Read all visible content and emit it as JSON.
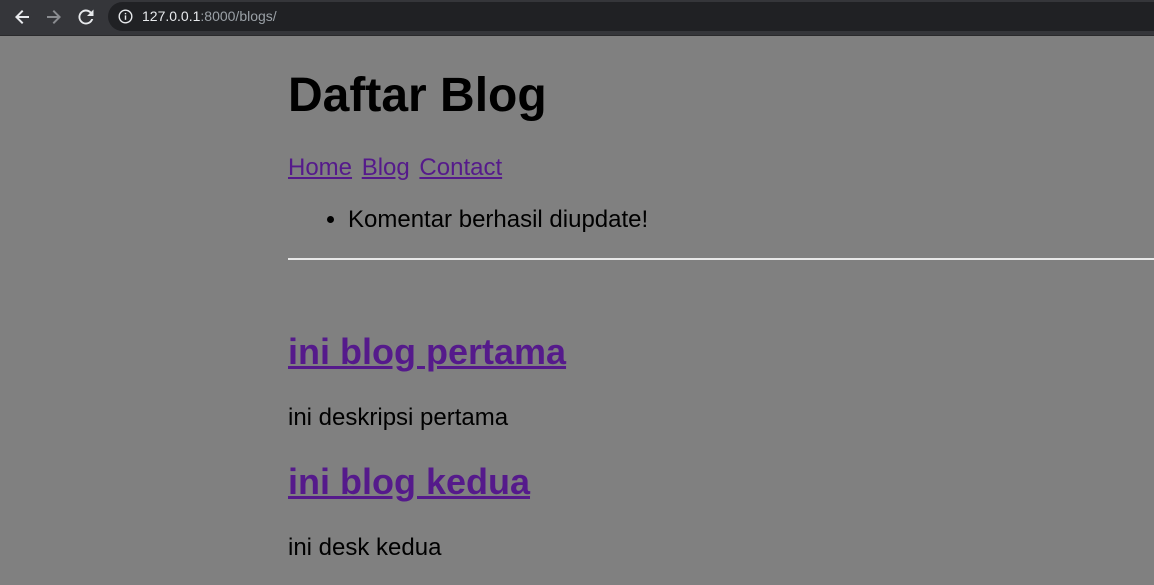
{
  "browser": {
    "url_host": "127.0.0.1",
    "url_path": ":8000/blogs/",
    "icons": {
      "back": "arrow-left-icon",
      "forward": "arrow-right-icon",
      "reload": "reload-icon",
      "info": "info-icon"
    }
  },
  "page": {
    "title": "Daftar Blog",
    "nav": {
      "home": "Home",
      "blog": "Blog",
      "contact": "Contact"
    },
    "messages": [
      "Komentar berhasil diupdate!"
    ],
    "blogs": [
      {
        "title": "ini blog pertama",
        "description": "ini deskripsi pertama"
      },
      {
        "title": "ini blog kedua",
        "description": "ini desk kedua"
      }
    ]
  },
  "colors": {
    "page_background": "#808080",
    "link_visited": "#551a8b",
    "toolbar": "#35363a",
    "omnibox": "#202124"
  }
}
